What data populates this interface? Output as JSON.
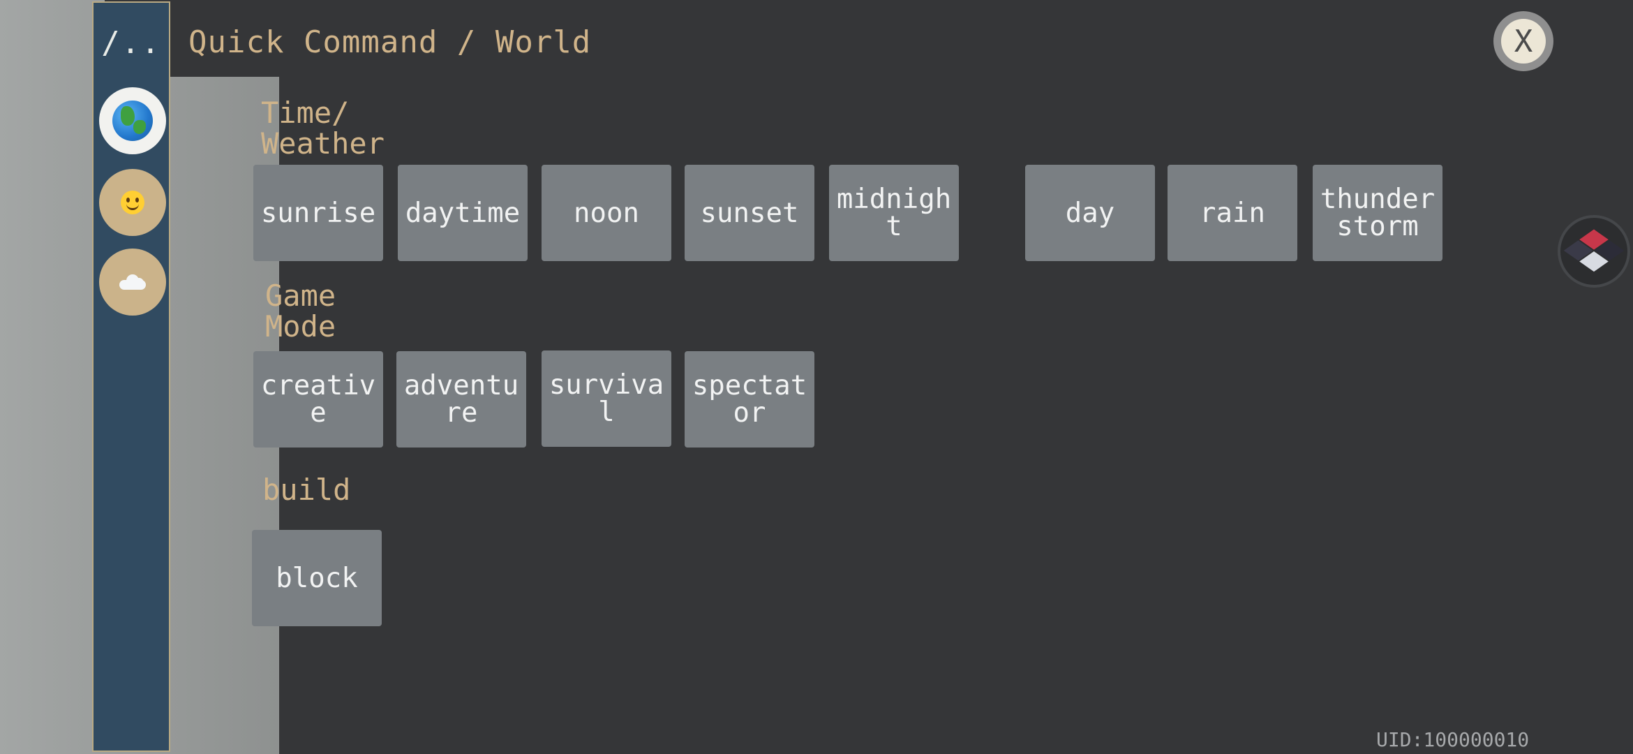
{
  "sidebar": {
    "back_label": "/..",
    "items": [
      {
        "icon": "globe-icon",
        "active": true
      },
      {
        "icon": "smiley-icon",
        "active": false
      },
      {
        "icon": "cloud-icon",
        "active": false
      }
    ]
  },
  "header": {
    "title": "Quick Command / World",
    "close_label": "X"
  },
  "sections": {
    "time_weather": {
      "label": "Time/\nWeather",
      "buttons": [
        "sunrise",
        "daytime",
        "noon",
        "sunset",
        "midnight",
        "day",
        "rain",
        "thunderstorm"
      ]
    },
    "game_mode": {
      "label": "Game\nMode",
      "buttons": [
        "creative",
        "adventure",
        "survival",
        "spectator"
      ]
    },
    "build": {
      "label": "build",
      "buttons": [
        "block"
      ]
    }
  },
  "floating_button": {
    "icon": "cube-icon"
  },
  "footer": {
    "uid": "UID:100000010"
  },
  "colors": {
    "background": "#353638",
    "sidebar": "#314b61",
    "accent_text": "#d0b48a",
    "button": "#7a7f83"
  }
}
